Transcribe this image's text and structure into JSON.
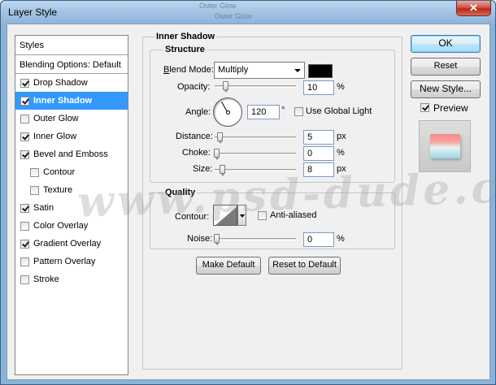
{
  "window": {
    "title": "Layer Style",
    "ghost_text": [
      "Outer Glow",
      "Outer Glow"
    ]
  },
  "styles": {
    "header": "Styles",
    "blending_options": "Blending Options: Default",
    "items": [
      {
        "label": "Drop Shadow",
        "checked": true,
        "selected": false,
        "sub": false
      },
      {
        "label": "Inner Shadow",
        "checked": true,
        "selected": true,
        "sub": false
      },
      {
        "label": "Outer Glow",
        "checked": false,
        "selected": false,
        "sub": false
      },
      {
        "label": "Inner Glow",
        "checked": true,
        "selected": false,
        "sub": false
      },
      {
        "label": "Bevel and Emboss",
        "checked": true,
        "selected": false,
        "sub": false
      },
      {
        "label": "Contour",
        "checked": false,
        "selected": false,
        "sub": true
      },
      {
        "label": "Texture",
        "checked": false,
        "selected": false,
        "sub": true
      },
      {
        "label": "Satin",
        "checked": true,
        "selected": false,
        "sub": false
      },
      {
        "label": "Color Overlay",
        "checked": false,
        "selected": false,
        "sub": false
      },
      {
        "label": "Gradient Overlay",
        "checked": true,
        "selected": false,
        "sub": false
      },
      {
        "label": "Pattern Overlay",
        "checked": false,
        "selected": false,
        "sub": false
      },
      {
        "label": "Stroke",
        "checked": false,
        "selected": false,
        "sub": false
      }
    ]
  },
  "inner_shadow": {
    "title": "Inner Shadow",
    "structure": {
      "title": "Structure",
      "blend_mode_label": "Blend Mode:",
      "blend_mode_value": "Multiply",
      "blend_color": "#000000",
      "opacity_label": "Opacity:",
      "opacity_value": "10",
      "opacity_unit": "%",
      "angle_label": "Angle:",
      "angle_value": "120",
      "angle_unit": "°",
      "global_light_label": "Use Global Light",
      "global_light_checked": false,
      "distance_label": "Distance:",
      "distance_value": "5",
      "distance_unit": "px",
      "choke_label": "Choke:",
      "choke_value": "0",
      "choke_unit": "%",
      "size_label": "Size:",
      "size_value": "8",
      "size_unit": "px"
    },
    "quality": {
      "title": "Quality",
      "contour_label": "Contour:",
      "anti_aliased_label": "Anti-aliased",
      "anti_aliased_checked": false,
      "noise_label": "Noise:",
      "noise_value": "0",
      "noise_unit": "%"
    },
    "make_default": "Make Default",
    "reset_default": "Reset to Default"
  },
  "actions": {
    "ok": "OK",
    "reset": "Reset",
    "new_style": "New Style...",
    "preview_label": "Preview",
    "preview_checked": true
  },
  "watermark": "www.psd-dude.com",
  "icons": {
    "close": "close-icon",
    "dropdown": "chevron-down-icon",
    "angle": "angle-dial-icon"
  }
}
